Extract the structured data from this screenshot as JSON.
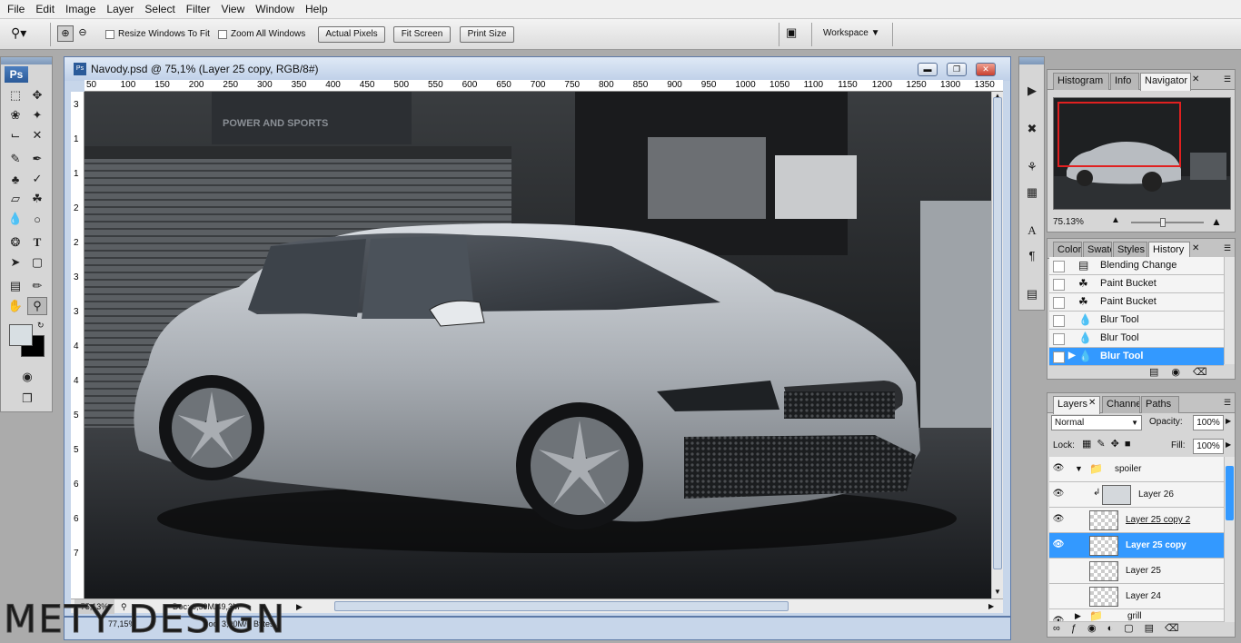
{
  "menubar": {
    "items": [
      "File",
      "Edit",
      "Image",
      "Layer",
      "Select",
      "Filter",
      "View",
      "Window",
      "Help"
    ]
  },
  "options": {
    "resize_windows": "Resize Windows To Fit",
    "zoom_all": "Zoom All Windows",
    "actual_pixels": "Actual Pixels",
    "fit_screen": "Fit Screen",
    "print_size": "Print Size",
    "workspace": "Workspace"
  },
  "toolbox": {
    "logo": "Ps"
  },
  "document": {
    "title": "Navody.psd @ 75,1% (Layer 25 copy, RGB/8#)",
    "zoom": "75,13%",
    "doc_size": "Doc: 6,59M/49,3M",
    "ruler_h": [
      "50",
      "100",
      "150",
      "200",
      "250",
      "300",
      "350",
      "400",
      "450",
      "500",
      "550",
      "600",
      "650",
      "700",
      "750",
      "800",
      "850",
      "900",
      "950",
      "1000",
      "1050",
      "1100",
      "1150",
      "1200",
      "1250",
      "1300",
      "1350"
    ],
    "ruler_v": [
      "3",
      "1",
      "1",
      "2",
      "2",
      "3",
      "3",
      "4",
      "4",
      "5",
      "5",
      "6",
      "6",
      "7"
    ],
    "banner_text": "POWER AND SPORTS"
  },
  "navigator": {
    "tabs": [
      "Histogram",
      "Info",
      "Navigator"
    ],
    "active_tab": "Navigator",
    "zoom": "75.13%"
  },
  "history": {
    "tabs": [
      "Color",
      "Swatc",
      "Styles",
      "History"
    ],
    "active_tab": "History",
    "items": [
      {
        "label": "Blending Change",
        "icon": "blending-icon"
      },
      {
        "label": "Paint Bucket",
        "icon": "paint-bucket-icon"
      },
      {
        "label": "Paint Bucket",
        "icon": "paint-bucket-icon"
      },
      {
        "label": "Blur Tool",
        "icon": "blur-icon"
      },
      {
        "label": "Blur Tool",
        "icon": "blur-icon"
      },
      {
        "label": "Blur Tool",
        "icon": "blur-icon"
      }
    ],
    "selected_index": 5
  },
  "layers": {
    "tabs": [
      "Layers",
      "Channels",
      "Paths"
    ],
    "active_tab": "Layers",
    "blend_mode": "Normal",
    "opacity_label": "Opacity:",
    "opacity": "100%",
    "lock_label": "Lock:",
    "fill_label": "Fill:",
    "fill": "100%",
    "rows": [
      {
        "label": "spoiler",
        "type": "group",
        "visible": true
      },
      {
        "label": "Layer 26",
        "type": "fill",
        "visible": true
      },
      {
        "label": "Layer 25 copy 2",
        "type": "layer",
        "visible": true
      },
      {
        "label": "Layer 25 copy",
        "type": "layer",
        "visible": true
      },
      {
        "label": "Layer 25",
        "type": "layer",
        "visible": false
      },
      {
        "label": "Layer 24",
        "type": "layer",
        "visible": false
      },
      {
        "label": "grill",
        "type": "group",
        "visible": true
      }
    ],
    "selected_index": 3
  },
  "second_doc": {
    "zoom": "77,15%",
    "doc_size": "Doc: 3,00M/0 Bytes"
  },
  "watermark": "METY DESIGN",
  "colors": {
    "selection": "#3399ff",
    "accent": "#2a5a99",
    "nav_box": "#e02020"
  }
}
